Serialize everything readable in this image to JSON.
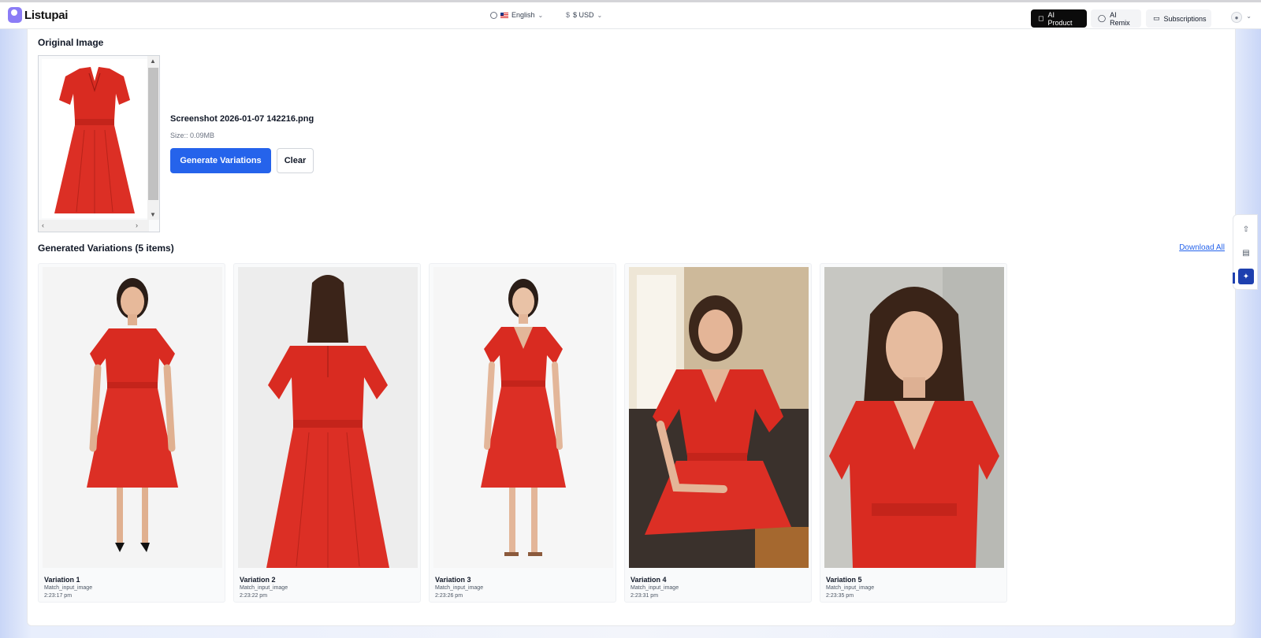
{
  "app": {
    "name": "Listupai"
  },
  "header": {
    "language": "English",
    "currency": "$ USD",
    "buttons": {
      "ai_product": "AI Product",
      "ai_remix": "AI Remix",
      "subscriptions": "Subscriptions"
    }
  },
  "original": {
    "section_title": "Original Image",
    "file_name": "Screenshot 2026-01-07 142216.png",
    "file_size": "Size:: 0.09MB",
    "generate_label": "Generate Variations",
    "clear_label": "Clear"
  },
  "generated": {
    "section_title": "Generated Variations (5 items)",
    "download_all": "Download All",
    "items": [
      {
        "title": "Variation 1",
        "style": "Match_input_image",
        "time": "2:23:17 pm"
      },
      {
        "title": "Variation 2",
        "style": "Match_input_image",
        "time": "2:23:22 pm"
      },
      {
        "title": "Variation 3",
        "style": "Match_input_image",
        "time": "2:23:26 pm"
      },
      {
        "title": "Variation 4",
        "style": "Match_input_image",
        "time": "2:23:31 pm"
      },
      {
        "title": "Variation 5",
        "style": "Match_input_image",
        "time": "2:23:35 pm"
      }
    ]
  },
  "colors": {
    "accent": "#2563eb",
    "dress": "#dc2626",
    "dark_button": "#0b0b0b"
  },
  "icons": [
    "globe-icon",
    "dollar-icon",
    "chevron-down-icon",
    "box-icon",
    "tag-icon",
    "card-icon",
    "user-icon",
    "upload-icon",
    "document-icon",
    "magic-wand-icon"
  ]
}
